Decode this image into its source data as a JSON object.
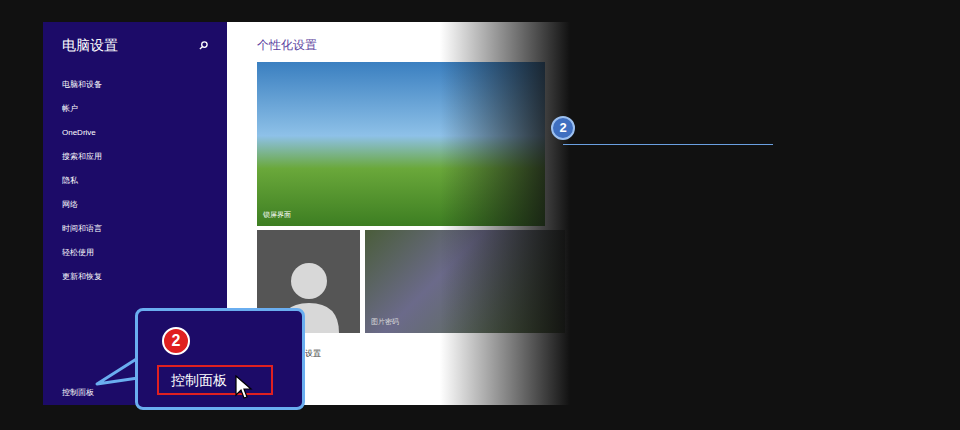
{
  "sidebar": {
    "title": "电脑设置",
    "items": [
      "电脑和设备",
      "帐户",
      "OneDrive",
      "搜索和应用",
      "隐私",
      "网络",
      "时间和语言",
      "轻松使用",
      "更新和恢复"
    ],
    "footer": "控制面板"
  },
  "content": {
    "title": "个性化设置",
    "tiles": [
      {
        "label": "锁屏界面"
      },
      {
        "label": ""
      },
      {
        "label": "图片密码"
      }
    ],
    "link": "设置"
  },
  "callout": {
    "badge": "2",
    "label": "控制面板"
  },
  "marker": {
    "badge": "2"
  }
}
